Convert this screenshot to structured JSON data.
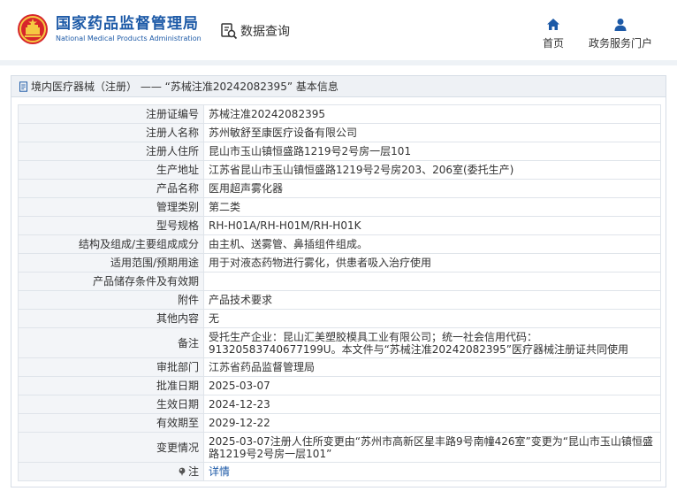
{
  "header": {
    "org_cn": "国家药品监督管理局",
    "org_en": "National Medical Products Administration",
    "query_label": "数据查询",
    "nav": [
      {
        "label": "首页",
        "icon": "home-icon"
      },
      {
        "label": "政务服务门户",
        "icon": "user-icon"
      }
    ]
  },
  "panel": {
    "title": "境内医疗器械（注册） —— “苏械注准20242082395” 基本信息"
  },
  "rows": [
    {
      "key": "注册证编号",
      "value": "苏械注准20242082395"
    },
    {
      "key": "注册人名称",
      "value": "苏州敏舒至康医疗设备有限公司"
    },
    {
      "key": "注册人住所",
      "value": "昆山市玉山镇恒盛路1219号2号房一层101"
    },
    {
      "key": "生产地址",
      "value": "江苏省昆山市玉山镇恒盛路1219号2号房203、206室(委托生产)"
    },
    {
      "key": "产品名称",
      "value": "医用超声雾化器"
    },
    {
      "key": "管理类别",
      "value": "第二类"
    },
    {
      "key": "型号规格",
      "value": "RH-H01A/RH-H01M/RH-H01K"
    },
    {
      "key": "结构及组成/主要组成成分",
      "value": "由主机、送雾管、鼻插组件组成。"
    },
    {
      "key": "适用范围/预期用途",
      "value": "用于对液态药物进行雾化，供患者吸入治疗使用"
    },
    {
      "key": "产品储存条件及有效期",
      "value": ""
    },
    {
      "key": "附件",
      "value": "产品技术要求"
    },
    {
      "key": "其他内容",
      "value": "无"
    },
    {
      "key": "备注",
      "value": "受托生产企业：昆山汇美塑胶模具工业有限公司；统一社会信用代码：91320583740677199U。本文件与“苏械注准20242082395”医疗器械注册证共同使用"
    },
    {
      "key": "审批部门",
      "value": "江苏省药品监督管理局"
    },
    {
      "key": "批准日期",
      "value": "2025-03-07"
    },
    {
      "key": "生效日期",
      "value": "2024-12-23"
    },
    {
      "key": "有效期至",
      "value": "2029-12-22"
    },
    {
      "key": "变更情况",
      "value": "2025-03-07注册人住所变更由“苏州市高新区星丰路9号南幢426室”变更为“昆山市玉山镇恒盛路1219号2号房一层101”"
    }
  ],
  "note": {
    "key": "注",
    "value": "详情",
    "icon": "pin-icon"
  },
  "colors": {
    "brand": "#1d5aa7",
    "emblem_red": "#d7262b",
    "emblem_gold": "#f5c842"
  }
}
